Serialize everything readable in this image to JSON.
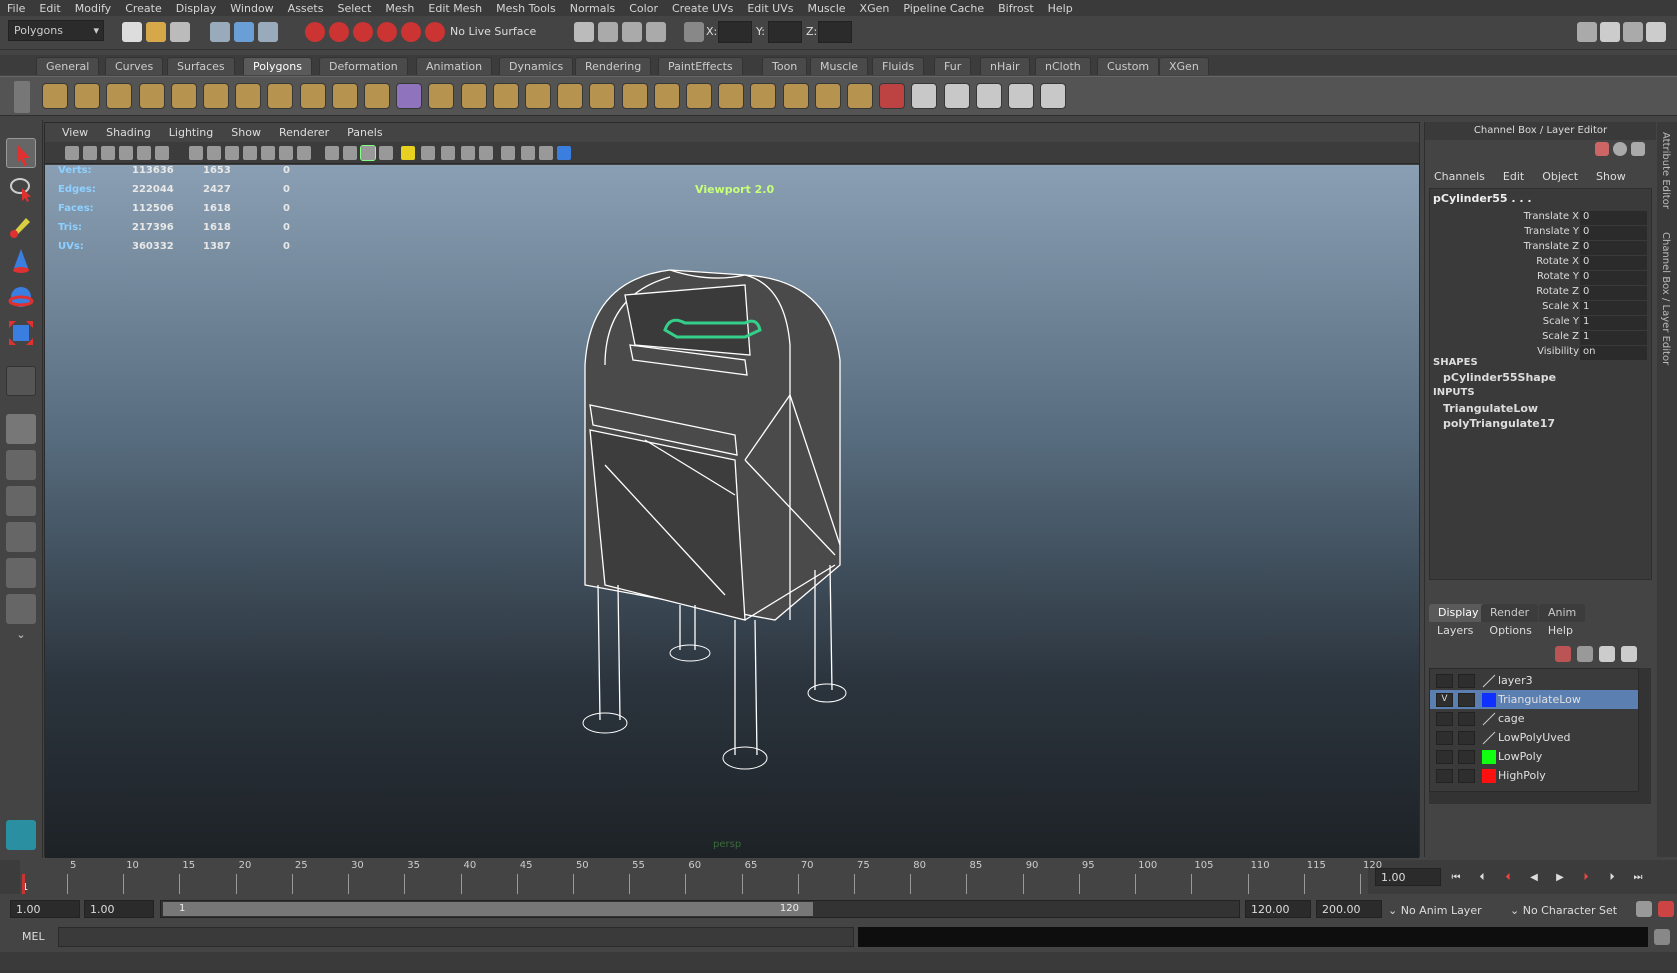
{
  "menubar": [
    "File",
    "Edit",
    "Modify",
    "Create",
    "Display",
    "Window",
    "Assets",
    "Select",
    "Mesh",
    "Edit Mesh",
    "Mesh Tools",
    "Normals",
    "Color",
    "Create UVs",
    "Edit UVs",
    "Muscle",
    "XGen",
    "Pipeline Cache",
    "Bifrost",
    "Help"
  ],
  "statusline": {
    "menuset": "Polygons",
    "live_surface": "No Live Surface",
    "x_label": "X:",
    "y_label": "Y:",
    "z_label": "Z:"
  },
  "shelf_tabs": [
    "General",
    "Curves",
    "Surfaces",
    "Polygons",
    "Deformation",
    "Animation",
    "Dynamics",
    "Rendering",
    "PaintEffects",
    "Toon",
    "Muscle",
    "Fluids",
    "Fur",
    "nHair",
    "nCloth",
    "Custom",
    "XGen"
  ],
  "shelf_active": "Polygons",
  "viewport": {
    "menu": [
      "View",
      "Shading",
      "Lighting",
      "Show",
      "Renderer",
      "Panels"
    ],
    "renderer_label": "Viewport 2.0",
    "camera": "persp",
    "hud": [
      {
        "label": "Verts:",
        "a": "113636",
        "b": "1653",
        "c": "0"
      },
      {
        "label": "Edges:",
        "a": "222044",
        "b": "2427",
        "c": "0"
      },
      {
        "label": "Faces:",
        "a": "112506",
        "b": "1618",
        "c": "0"
      },
      {
        "label": "Tris:",
        "a": "217396",
        "b": "1618",
        "c": "0"
      },
      {
        "label": "UVs:",
        "a": "360332",
        "b": "1387",
        "c": "0"
      }
    ]
  },
  "channel_box": {
    "title": "Channel Box / Layer Editor",
    "menu": [
      "Channels",
      "Edit",
      "Object",
      "Show"
    ],
    "object": "pCylinder55 . . .",
    "attrs": [
      {
        "name": "Translate X",
        "value": "0"
      },
      {
        "name": "Translate Y",
        "value": "0"
      },
      {
        "name": "Translate Z",
        "value": "0"
      },
      {
        "name": "Rotate X",
        "value": "0"
      },
      {
        "name": "Rotate Y",
        "value": "0"
      },
      {
        "name": "Rotate Z",
        "value": "0"
      },
      {
        "name": "Scale X",
        "value": "1"
      },
      {
        "name": "Scale Y",
        "value": "1"
      },
      {
        "name": "Scale Z",
        "value": "1"
      },
      {
        "name": "Visibility",
        "value": "on"
      }
    ],
    "shapes_header": "SHAPES",
    "shape": "pCylinder55Shape",
    "inputs_header": "INPUTS",
    "inputs": [
      "TriangulateLow",
      "polyTriangulate17"
    ]
  },
  "side_tabs": [
    "Attribute Editor",
    "Channel Box / Layer Editor"
  ],
  "layer_editor": {
    "tabs": [
      "Display",
      "Render",
      "Anim"
    ],
    "active_tab": "Display",
    "menu": [
      "Layers",
      "Options",
      "Help"
    ],
    "layers": [
      {
        "name": "layer3",
        "v": "",
        "color": ""
      },
      {
        "name": "TriangulateLow",
        "v": "V",
        "color": "#1030ff",
        "selected": true
      },
      {
        "name": "cage",
        "v": "",
        "color": ""
      },
      {
        "name": "LowPolyUved",
        "v": "",
        "color": ""
      },
      {
        "name": "LowPoly",
        "v": "",
        "color": "#10ff10"
      },
      {
        "name": "HighPoly",
        "v": "",
        "color": "#ff1010"
      }
    ]
  },
  "timeline": {
    "current_frame_label": "1",
    "ticks": [
      "5",
      "10",
      "15",
      "20",
      "25",
      "30",
      "35",
      "40",
      "45",
      "50",
      "55",
      "60",
      "65",
      "70",
      "75",
      "80",
      "85",
      "90",
      "95",
      "100",
      "105",
      "110",
      "115",
      "120"
    ],
    "current_time": "1.00"
  },
  "range": {
    "start": "1.00",
    "anim_start": "1.00",
    "slider_start": "1",
    "slider_end": "120",
    "end": "120.00",
    "anim_end": "200.00",
    "anim_layer": "No Anim Layer",
    "character_set": "No Character Set"
  },
  "command": {
    "lang": "MEL"
  }
}
